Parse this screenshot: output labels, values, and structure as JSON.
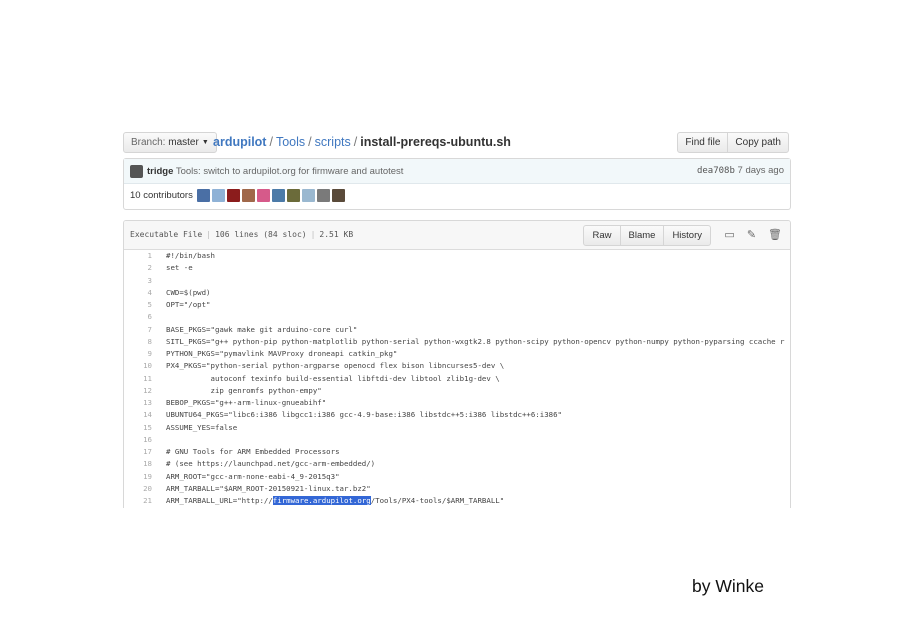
{
  "toolbar": {
    "branch_prefix": "Branch:",
    "branch_name": "master",
    "repo": "ardupilot",
    "path1": "Tools",
    "path2": "scripts",
    "filename": "install-prereqs-ubuntu.sh",
    "find_file": "Find file",
    "copy_path": "Copy path"
  },
  "commit": {
    "author": "tridge",
    "message": "Tools: switch to ardupilot.org for firmware and autotest",
    "sha": "dea708b",
    "age": "7 days ago",
    "contributors_label": "10 contributors",
    "avatar_colors": [
      "#4a6fa5",
      "#8fb2d6",
      "#8b1c1c",
      "#a0684a",
      "#d65a8a",
      "#4c7ba8",
      "#6b6b3a",
      "#9ab8d0",
      "#7a7a7a",
      "#5a4a3a"
    ]
  },
  "file": {
    "info_type": "Executable File",
    "info_lines": "106 lines (84 sloc)",
    "info_size": "2.51 KB",
    "raw": "Raw",
    "blame": "Blame",
    "history": "History",
    "icons": [
      "desktop-icon",
      "pencil-icon",
      "trash-icon"
    ]
  },
  "code_lines": [
    {
      "n": "1",
      "text": "#!/bin/bash"
    },
    {
      "n": "2",
      "text": "set -e"
    },
    {
      "n": "3",
      "text": ""
    },
    {
      "n": "4",
      "text": "CWD=$(pwd)"
    },
    {
      "n": "5",
      "text": "OPT=\"/opt\""
    },
    {
      "n": "6",
      "text": ""
    },
    {
      "n": "7",
      "text": "BASE_PKGS=\"gawk make git arduino-core curl\""
    },
    {
      "n": "8",
      "text": "SITL_PKGS=\"g++ python-pip python-matplotlib python-serial python-wxgtk2.8 python-scipy python-opencv python-numpy python-pyparsing ccache r"
    },
    {
      "n": "9",
      "text": "PYTHON_PKGS=\"pymavlink MAVProxy droneapi catkin_pkg\""
    },
    {
      "n": "10",
      "text": "PX4_PKGS=\"python-serial python-argparse openocd flex bison libncurses5-dev \\"
    },
    {
      "n": "11",
      "text": "          autoconf texinfo build-essential libftdi-dev libtool zlib1g-dev \\"
    },
    {
      "n": "12",
      "text": "          zip genromfs python-empy\""
    },
    {
      "n": "13",
      "text": "BEBOP_PKGS=\"g++-arm-linux-gnueabihf\""
    },
    {
      "n": "14",
      "text": "UBUNTU64_PKGS=\"libc6:i386 libgcc1:i386 gcc-4.9-base:i386 libstdc++5:i386 libstdc++6:i386\""
    },
    {
      "n": "15",
      "text": "ASSUME_YES=false"
    },
    {
      "n": "16",
      "text": ""
    },
    {
      "n": "17",
      "text": "# GNU Tools for ARM Embedded Processors"
    },
    {
      "n": "18",
      "text": "# (see https://launchpad.net/gcc-arm-embedded/)"
    },
    {
      "n": "19",
      "text": "ARM_ROOT=\"gcc-arm-none-eabi-4_9-2015q3\""
    },
    {
      "n": "20",
      "text": "ARM_TARBALL=\"$ARM_ROOT-20150921-linux.tar.bz2\""
    },
    {
      "n": "21",
      "pre": "ARM_TARBALL_URL=\"http://",
      "hl": "firmware.ardupilot.org",
      "post": "/Tools/PX4-tools/$ARM_TARBALL\""
    }
  ],
  "signature": "by Winke"
}
